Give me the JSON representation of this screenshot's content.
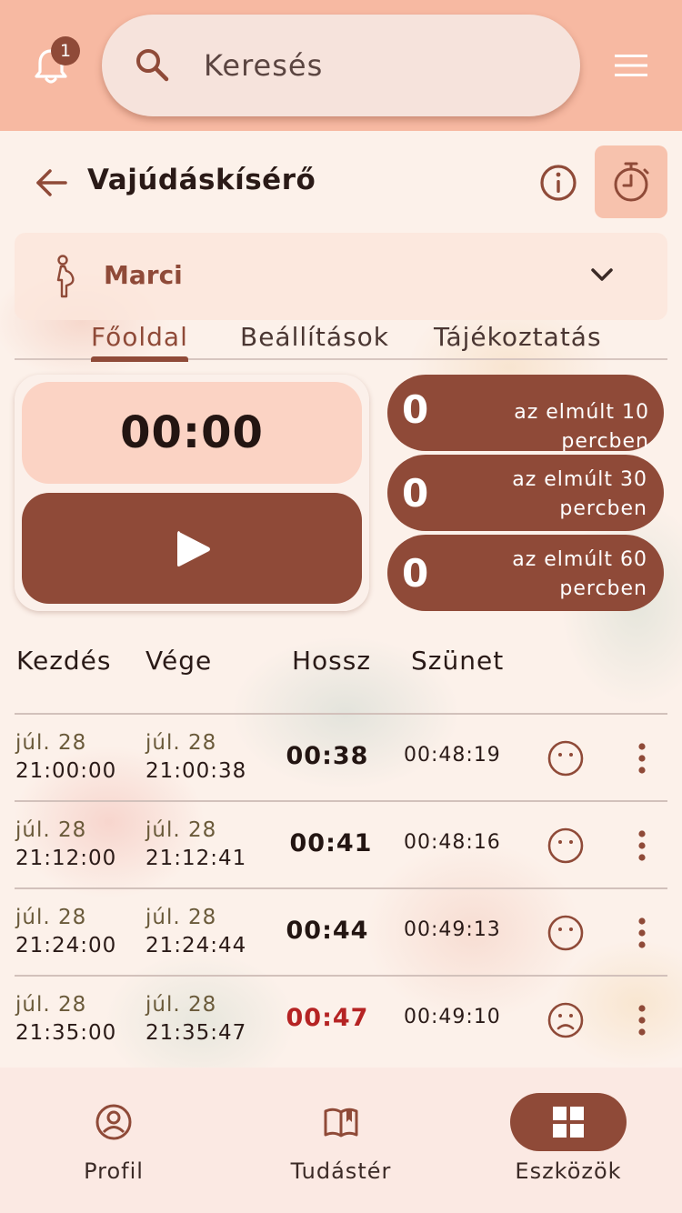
{
  "topbar": {
    "notification_count": "1",
    "search_placeholder": "Keresés"
  },
  "header": {
    "title": "Vajúdáskísérő"
  },
  "person": {
    "name": "Marci"
  },
  "tabs": [
    {
      "label": "Főoldal",
      "active": true
    },
    {
      "label": "Beállítások",
      "active": false
    },
    {
      "label": "Tájékoztatás",
      "active": false
    }
  ],
  "timer": {
    "display": "00:00"
  },
  "stats": [
    {
      "value": "0",
      "label": "az elmúlt 10 percben"
    },
    {
      "value": "0",
      "label": "az elmúlt 30 percben"
    },
    {
      "value": "0",
      "label": "az elmúlt 60 percben"
    }
  ],
  "table": {
    "headers": [
      "Kezdés",
      "Vége",
      "Hossz",
      "Szünet"
    ],
    "rows": [
      {
        "start_date": "júl. 28",
        "start_time": "21:00:00",
        "end_date": "júl. 28",
        "end_time": "21:00:38",
        "length": "00:38",
        "pause": "00:48:19",
        "mood": "neutral"
      },
      {
        "start_date": "júl. 28",
        "start_time": "21:12:00",
        "end_date": "júl. 28",
        "end_time": "21:12:41",
        "length": "00:41",
        "pause": "00:48:16",
        "mood": "neutral"
      },
      {
        "start_date": "júl. 28",
        "start_time": "21:24:00",
        "end_date": "júl. 28",
        "end_time": "21:24:44",
        "length": "00:44",
        "pause": "00:49:13",
        "mood": "neutral"
      },
      {
        "start_date": "júl. 28",
        "start_time": "21:35:00",
        "end_date": "júl. 28",
        "end_time": "21:35:47",
        "length": "00:47",
        "pause": "00:49:10",
        "mood": "sad",
        "alert": true
      }
    ]
  },
  "bottom_nav": [
    {
      "label": "Profil",
      "icon": "profile-icon",
      "active": false
    },
    {
      "label": "Tudástér",
      "icon": "book-icon",
      "active": false
    },
    {
      "label": "Eszközök",
      "icon": "grid-icon",
      "active": true
    }
  ],
  "colors": {
    "accent": "#8f4a38",
    "topbar": "#f7b9a2",
    "alert": "#b52323"
  }
}
